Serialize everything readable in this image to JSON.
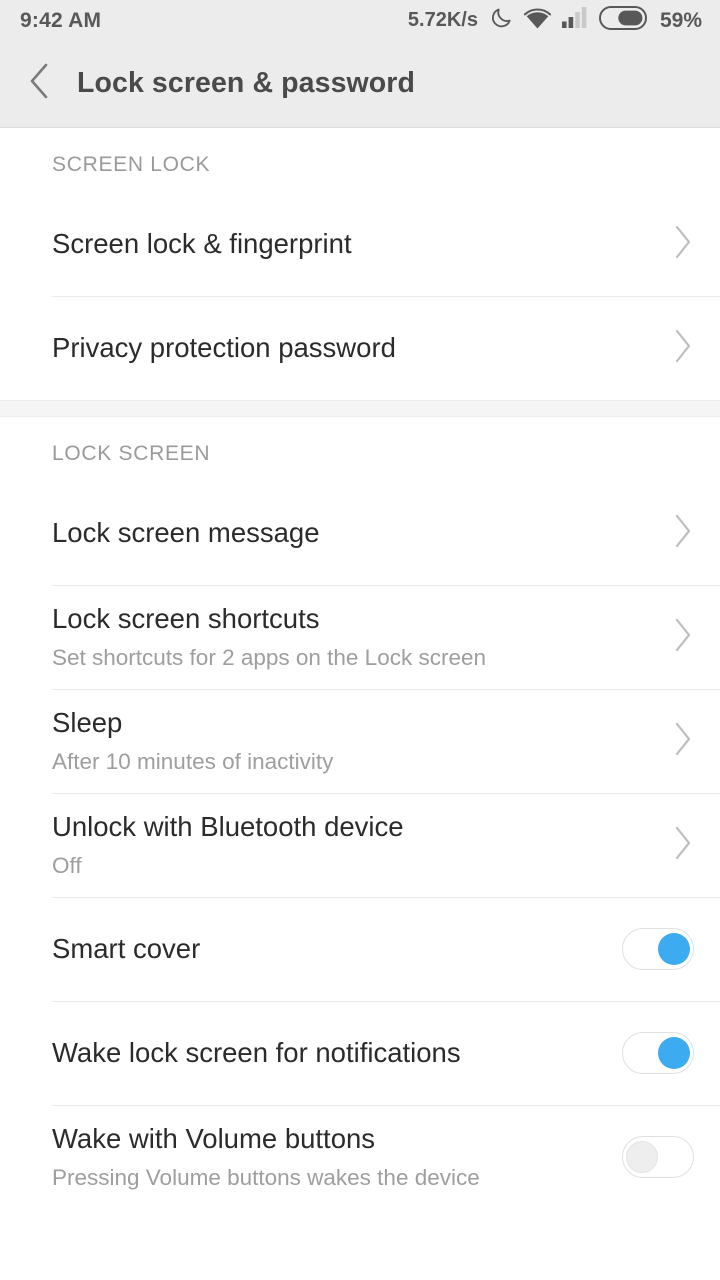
{
  "status_bar": {
    "time": "9:42 AM",
    "network_speed": "5.72K/s",
    "battery_percent": "59%",
    "icons": [
      "do-not-disturb-moon-icon",
      "wifi-icon",
      "cellular-signal-icon",
      "battery-icon"
    ],
    "battery_level": 59,
    "signal_bars_filled": 2,
    "signal_bars_total": 4,
    "text_color": "#585858",
    "background": "#ececec"
  },
  "header": {
    "back_icon": "chevron-left-icon",
    "title": "Lock screen & password",
    "background": "#ececec"
  },
  "theme": {
    "accent": "#3cabf0",
    "title_text": "#2b2b2b",
    "subtitle_text": "#9e9e9e",
    "section_text": "#9a9a9a",
    "divider": "#ebebeb",
    "page_background": "#ffffff",
    "section_gap_background": "#f5f5f5"
  },
  "sections": [
    {
      "header": "SCREEN LOCK",
      "rows": [
        {
          "title": "Screen lock & fingerprint",
          "subtitle": "",
          "accessory": "chevron-right-icon"
        },
        {
          "title": "Privacy protection password",
          "subtitle": "",
          "accessory": "chevron-right-icon"
        }
      ]
    },
    {
      "header": "LOCK SCREEN",
      "rows": [
        {
          "title": "Lock screen message",
          "subtitle": "",
          "accessory": "chevron-right-icon"
        },
        {
          "title": "Lock screen shortcuts",
          "subtitle": "Set shortcuts for 2 apps on the Lock screen",
          "accessory": "chevron-right-icon"
        },
        {
          "title": "Sleep",
          "subtitle": "After 10 minutes of inactivity",
          "accessory": "chevron-right-icon"
        },
        {
          "title": "Unlock with Bluetooth device",
          "subtitle": "Off",
          "accessory": "chevron-right-icon"
        },
        {
          "title": "Smart cover",
          "subtitle": "",
          "accessory": "toggle-switch",
          "toggle_state": "on"
        },
        {
          "title": "Wake lock screen for notifications",
          "subtitle": "",
          "accessory": "toggle-switch",
          "toggle_state": "on"
        },
        {
          "title": "Wake with Volume buttons",
          "subtitle": "Pressing Volume buttons wakes the device",
          "accessory": "toggle-switch",
          "toggle_state": "off"
        }
      ]
    }
  ]
}
